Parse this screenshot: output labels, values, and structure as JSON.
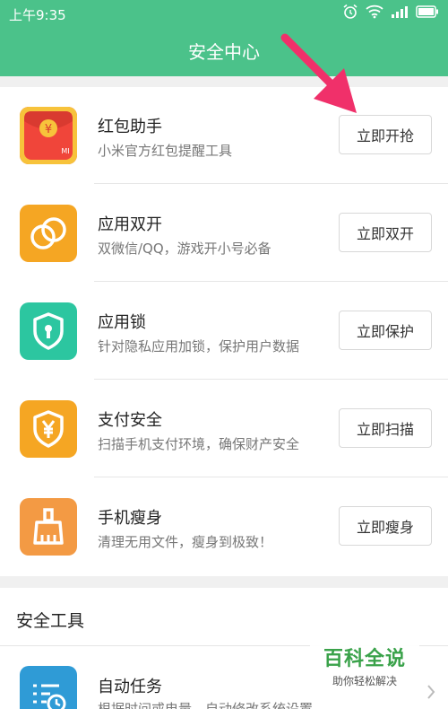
{
  "status_bar": {
    "time": "上午9:35",
    "icons": [
      "alarm-icon",
      "wifi-icon",
      "signal-icon",
      "battery-icon"
    ]
  },
  "header": {
    "title": "安全中心",
    "color": "#4bc28a"
  },
  "features": [
    {
      "title": "红包助手",
      "subtitle": "小米官方红包提醒工具",
      "button": "立即开抢",
      "icon": "red-envelope-icon",
      "icon_color": "#f0453a",
      "icon_badge": "MI",
      "icon_symbol": "¥"
    },
    {
      "title": "应用双开",
      "subtitle": "双微信/QQ，游戏开小号必备",
      "button": "立即双开",
      "icon": "dual-circles-icon",
      "icon_color": "#f5a623"
    },
    {
      "title": "应用锁",
      "subtitle": "针对隐私应用加锁，保护用户数据",
      "button": "立即保护",
      "icon": "shield-lock-icon",
      "icon_color": "#2cc6a0"
    },
    {
      "title": "支付安全",
      "subtitle": "扫描手机支付环境，确保财产安全",
      "button": "立即扫描",
      "icon": "yuan-shield-icon",
      "icon_color": "#f5a623",
      "icon_symbol": "¥"
    },
    {
      "title": "手机瘦身",
      "subtitle": "清理无用文件，瘦身到极致！",
      "button": "立即瘦身",
      "icon": "broom-icon",
      "icon_color": "#f39a44"
    }
  ],
  "tools_section": {
    "title": "安全工具",
    "items": [
      {
        "title": "自动任务",
        "subtitle": "根据时间或电量，自动修改系统设置",
        "icon": "task-schedule-icon",
        "icon_color": "#2f9bd6"
      }
    ]
  },
  "watermark": {
    "main": "百科全说",
    "sub": "助你轻松解决",
    "color": "#3aa24a"
  },
  "annotation": {
    "icon": "pink-arrow-icon",
    "color": "#f0306a"
  }
}
